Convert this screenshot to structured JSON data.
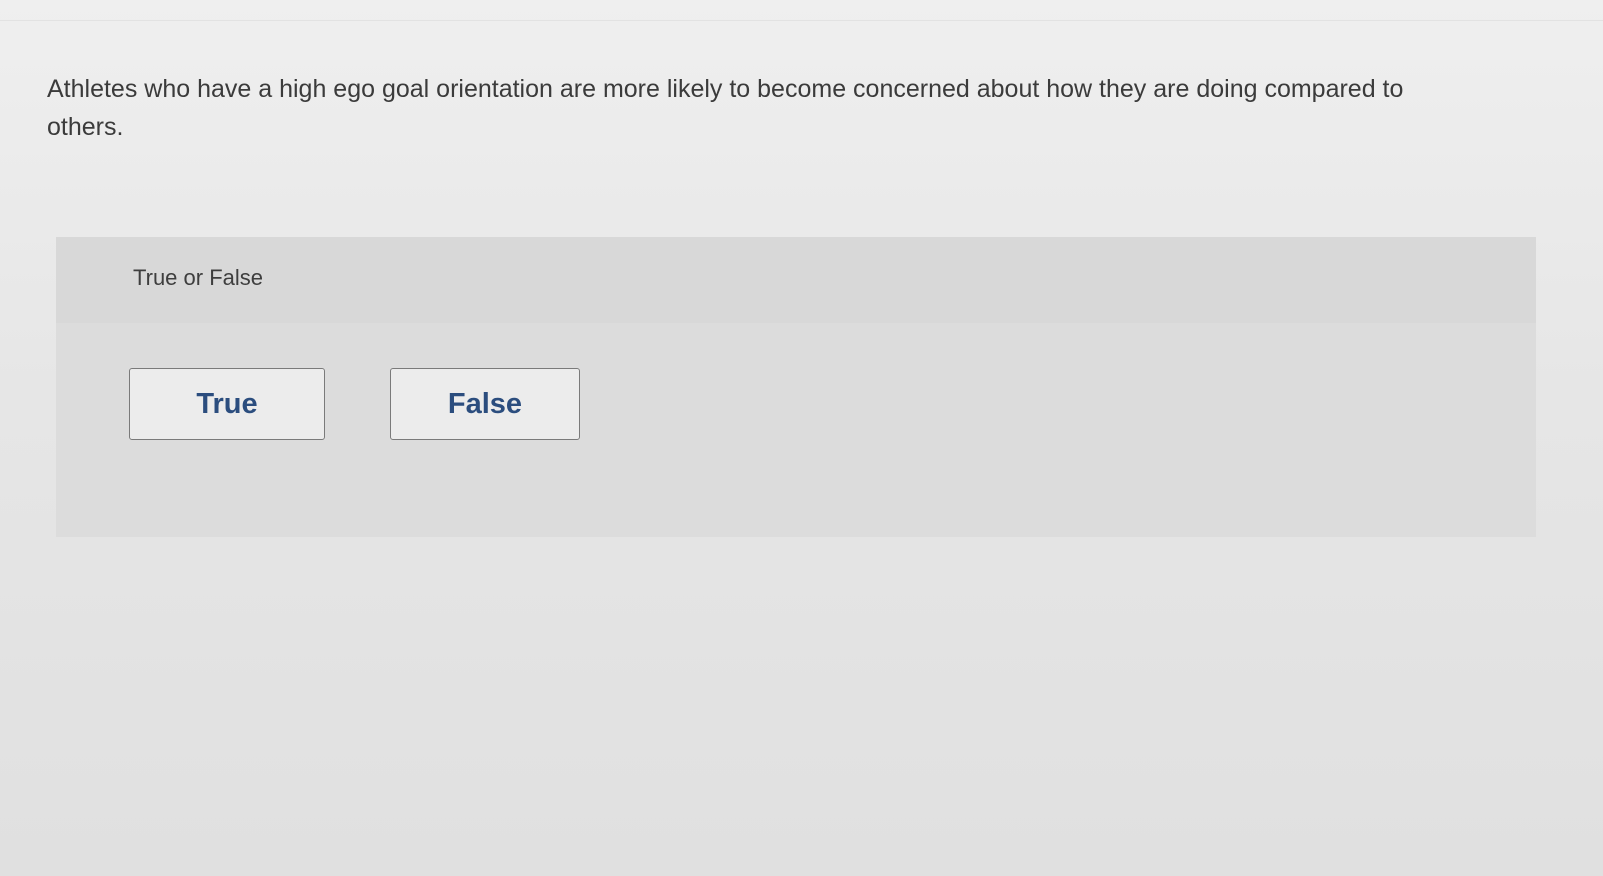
{
  "question": {
    "text": "Athletes who have a high ego goal orientation are more likely to become concerned about how they are doing compared to others."
  },
  "answer_panel": {
    "type_label": "True or False",
    "choices": [
      {
        "label": "True"
      },
      {
        "label": "False"
      }
    ]
  },
  "colors": {
    "choice_text": "#2b4d7e",
    "panel_background": "#dcdcdc",
    "page_background": "#e8e8e8"
  }
}
